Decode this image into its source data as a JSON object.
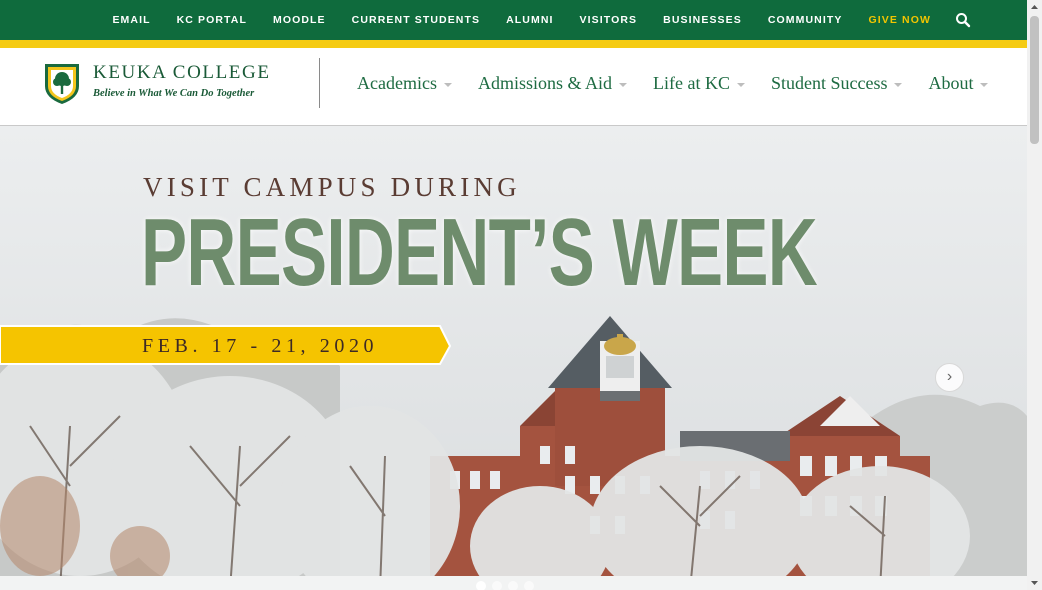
{
  "utility_nav": {
    "links": [
      {
        "label": "EMAIL"
      },
      {
        "label": "KC PORTAL"
      },
      {
        "label": "MOODLE"
      },
      {
        "label": "CURRENT STUDENTS"
      },
      {
        "label": "ALUMNI"
      },
      {
        "label": "VISITORS"
      },
      {
        "label": "BUSINESSES"
      },
      {
        "label": "COMMUNITY"
      },
      {
        "label": "GIVE NOW"
      }
    ],
    "search_icon": "search-icon"
  },
  "brand": {
    "name": "KEUKA COLLEGE",
    "tagline": "Believe in What We Can Do Together"
  },
  "main_nav": {
    "items": [
      {
        "label": "Academics"
      },
      {
        "label": "Admissions & Aid"
      },
      {
        "label": "Life at KC"
      },
      {
        "label": "Student Success"
      },
      {
        "label": "About"
      }
    ]
  },
  "hero": {
    "kicker": "VISIT CAMPUS DURING",
    "title": "PRESIDENT’S WEEK",
    "date": "FEB. 17 - 21, 2020",
    "next_label": "›",
    "slide_count": 4,
    "active_slide": 1
  },
  "colors": {
    "brand_green": "#0f6b3d",
    "gold": "#f5cb13",
    "nav_text": "#1e6b42",
    "title_green": "#6e8c6c",
    "brick": "#a4533f"
  }
}
